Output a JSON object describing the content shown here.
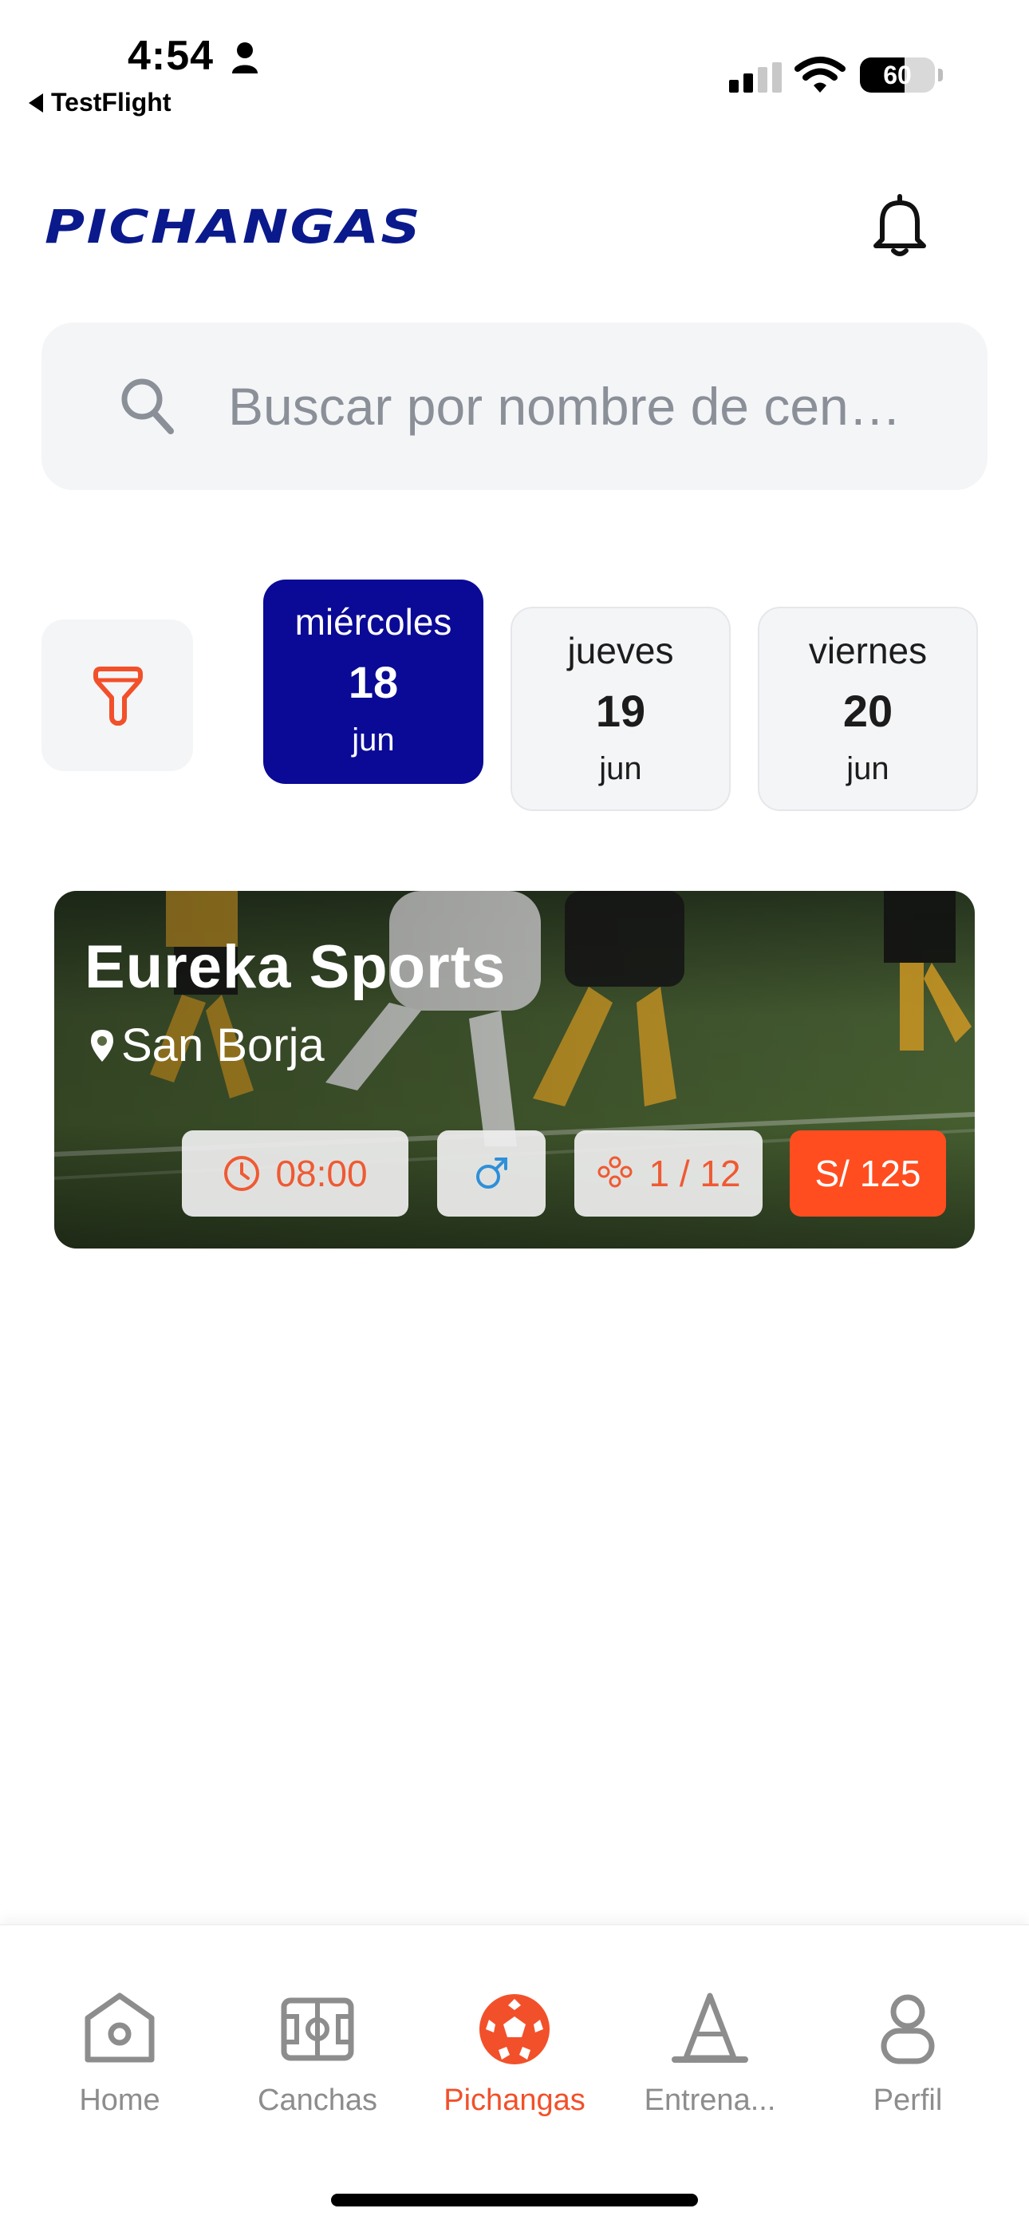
{
  "status_bar": {
    "time": "4:54",
    "back_app": "TestFlight",
    "battery": "60",
    "battery_level": 0.6
  },
  "header": {
    "logo": "PICHANGAS",
    "notification_icon": "bell-icon"
  },
  "search": {
    "placeholder": "Buscar por nombre de cen…"
  },
  "filter": {
    "icon": "filter-icon"
  },
  "dates": [
    {
      "dow": "miércoles",
      "day": "18",
      "month": "jun",
      "selected": true
    },
    {
      "dow": "jueves",
      "day": "19",
      "month": "jun",
      "selected": false
    },
    {
      "dow": "viernes",
      "day": "20",
      "month": "jun",
      "selected": false
    }
  ],
  "match": {
    "venue": "Eureka Sports",
    "district": "San Borja",
    "time": "08:00",
    "gender_icon": "male-icon",
    "players": "1 / 12",
    "price": "S/ 125"
  },
  "tabs": [
    {
      "label": "Home",
      "icon": "home-icon",
      "active": false
    },
    {
      "label": "Canchas",
      "icon": "field-icon",
      "active": false
    },
    {
      "label": "Pichangas",
      "icon": "soccer-ball-icon",
      "active": true
    },
    {
      "label": "Entrena...",
      "icon": "cone-icon",
      "active": false
    },
    {
      "label": "Perfil",
      "icon": "profile-icon",
      "active": false
    }
  ],
  "colors": {
    "brand_navy": "#0a1a8c",
    "selected_date": "#0a0a96",
    "accent_orange": "#f2502a",
    "price_chip": "#ff4d1f",
    "male_blue": "#2f8fd8"
  }
}
